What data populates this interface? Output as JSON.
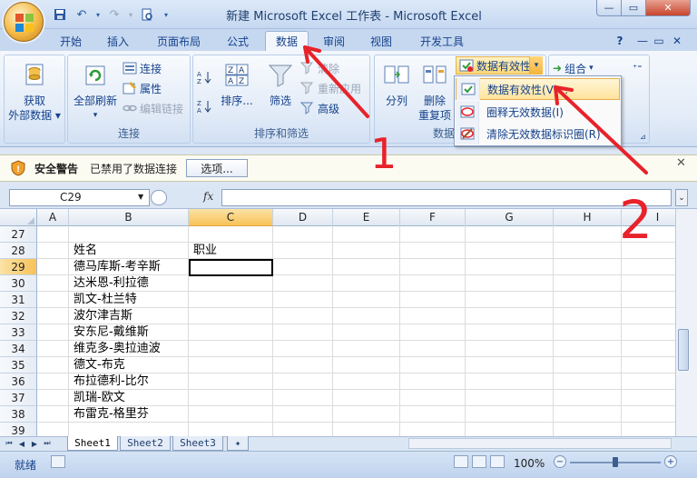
{
  "window": {
    "title": "新建 Microsoft Excel 工作表 - Microsoft Excel"
  },
  "tabs": [
    {
      "label": "开始"
    },
    {
      "label": "插入"
    },
    {
      "label": "页面布局"
    },
    {
      "label": "公式"
    },
    {
      "label": "数据",
      "active": true
    },
    {
      "label": "审阅"
    },
    {
      "label": "视图"
    },
    {
      "label": "开发工具"
    }
  ],
  "ribbon": {
    "get_external": {
      "line1": "获取",
      "line2": "外部数据"
    },
    "connections": {
      "refresh_all": "全部刷新",
      "connections": "连接",
      "properties": "属性",
      "edit_links": "编辑链接",
      "group_label": "连接"
    },
    "sort_filter": {
      "sort": "排序...",
      "filter": "筛选",
      "clear": "清除",
      "reapply": "重新应用",
      "advanced": "高级",
      "group_label": "排序和筛选"
    },
    "data_tools": {
      "split": "分列",
      "remove_dup_1": "删除",
      "remove_dup_2": "重复项",
      "data_validation": "数据有效性",
      "group_label": "数据"
    },
    "outline": {
      "group": "组合"
    }
  },
  "dropdown": {
    "items": [
      {
        "label": "数据有效性(V)..."
      },
      {
        "label": "圈释无效数据(I)"
      },
      {
        "label": "清除无效数据标识圈(R)"
      }
    ]
  },
  "security": {
    "title": "安全警告",
    "message": "已禁用了数据连接",
    "options": "选项..."
  },
  "formula_bar": {
    "name_box": "C29",
    "fx": "fx",
    "value": ""
  },
  "grid": {
    "columns": [
      "A",
      "B",
      "C",
      "D",
      "E",
      "F",
      "G",
      "H",
      "I"
    ],
    "rows": [
      "27",
      "28",
      "29",
      "30",
      "31",
      "32",
      "33",
      "34",
      "35",
      "36",
      "37",
      "38",
      "39"
    ],
    "cells": {
      "B28": "姓名",
      "C28": "职业",
      "B29": "德马库斯-考辛斯",
      "B30": "达米恩-利拉德",
      "B31": "凯文-杜兰特",
      "B32": "波尔津吉斯",
      "B33": "安东尼-戴维斯",
      "B34": "维克多-奥拉迪波",
      "B35": "德文-布克",
      "B36": "布拉德利-比尔",
      "B37": "凯瑞-欧文",
      "B38": "布雷克-格里芬"
    }
  },
  "sheets": [
    "Sheet1",
    "Sheet2",
    "Sheet3"
  ],
  "status": {
    "mode": "就绪",
    "zoom": "100%"
  },
  "annotations": {
    "one": "1",
    "two": "2"
  },
  "colors": {
    "accent": "#15428b",
    "active_tab_bg": "#f3f7fc",
    "annotation_red": "#e8222a",
    "highlight": "#fbd678"
  }
}
